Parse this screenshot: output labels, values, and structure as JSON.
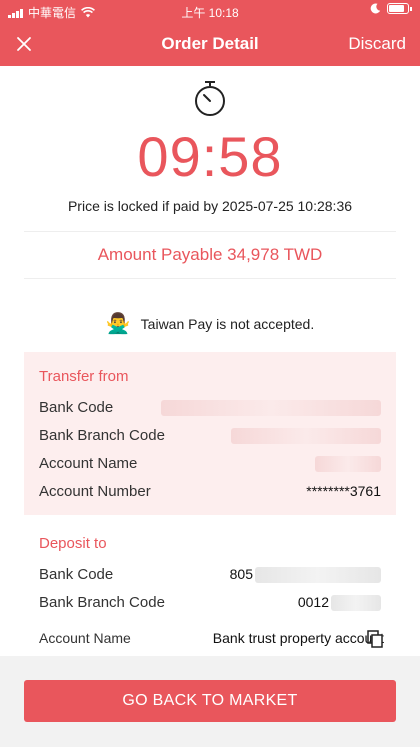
{
  "status_bar": {
    "carrier": "中華電信",
    "time": "上午 10:18"
  },
  "nav": {
    "title": "Order Detail",
    "discard_label": "Discard"
  },
  "timer": {
    "countdown": "09:58",
    "lock_text": "Price is locked if paid by 2025-07-25 10:28:36"
  },
  "amount": {
    "text": "Amount Payable 34,978 TWD"
  },
  "notice": {
    "emoji": "🙅‍♂️",
    "text": "Taiwan Pay is not accepted."
  },
  "transfer_from": {
    "title": "Transfer from",
    "rows": [
      {
        "label": "Bank Code",
        "value": ""
      },
      {
        "label": "Bank Branch Code",
        "value": ""
      },
      {
        "label": "Account Name",
        "value": ""
      },
      {
        "label": "Account Number",
        "value": "********3761"
      }
    ]
  },
  "deposit_to": {
    "title": "Deposit to",
    "rows": [
      {
        "label": "Bank Code",
        "value": "805"
      },
      {
        "label": "Bank Branch Code",
        "value": "0012"
      },
      {
        "label": "Account Name",
        "value": "Bank trust property account"
      }
    ]
  },
  "cta": {
    "label": "GO BACK TO MARKET"
  },
  "colors": {
    "accent": "#e9565c",
    "card_bg": "#fdeeee"
  }
}
